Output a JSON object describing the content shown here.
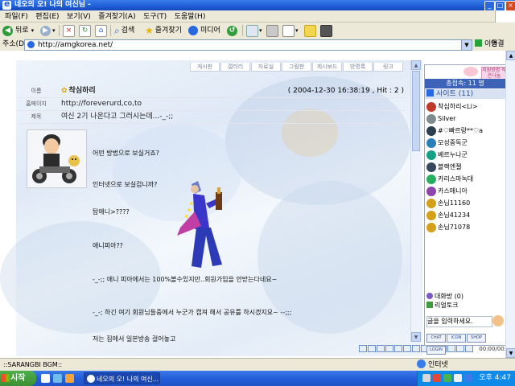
{
  "window": {
    "title": "네오의 오! 나의 여신님 -"
  },
  "menu": [
    "파일(F)",
    "편집(E)",
    "보기(V)",
    "즐겨찾기(A)",
    "도구(T)",
    "도움말(H)"
  ],
  "toolbar": {
    "back": "뒤로",
    "search": "검색",
    "favorites": "즐겨찾기",
    "media": "미디어"
  },
  "address": {
    "label": "주소(D)",
    "url": "http://amgkorea.net/",
    "go": "이동",
    "links": "연결"
  },
  "top_nav": [
    "게시판",
    "갤러리",
    "자료실",
    "그림판",
    "게시보드",
    "방명록",
    "링크"
  ],
  "post": {
    "name_label": "이름",
    "author": "착심하리",
    "date": "( 2004-12-30 16:38:19 , Hit : 2 )",
    "homepage_label": "홈페이지",
    "homepage": "http://foreverurd,co,to",
    "subject_label": "제목",
    "subject": "여신 2기 나온다고 그러시는데...-_-;;",
    "lines": [
      "어떤 방법으로 보실거죠?",
      "인터넷으로 보실겁니까?",
      "탑애니>????",
      "애니피아??",
      "-_-;; 애니 피아에서는 100%볼수있지만..회원가입을 안받는다네요~",
      "-_-; 하긴 여기 회원님들중에서 누군가 캡져 해서 공유를 하시겠지요~ --;;;",
      "저는 집에서 일본방송 걸어놓고"
    ]
  },
  "player": {
    "time": "00:00/00:00"
  },
  "sidebar": {
    "badge": "지원방명 작은나눔",
    "count": "총접속: 11 명",
    "site_header": "사이트 (11)",
    "users": [
      {
        "name": "착심하리<Li>",
        "color": "#c0392b"
      },
      {
        "name": "Silver",
        "color": "#7f8c8d"
      },
      {
        "name": "#♡빠르랑**♡a",
        "color": "#2c3e50"
      },
      {
        "name": "모성중독군",
        "color": "#2980b9"
      },
      {
        "name": "베르누나군",
        "color": "#16a085"
      },
      {
        "name": "블랙엔젤",
        "color": "#34495e"
      },
      {
        "name": "카리스마녹대",
        "color": "#27ae60"
      },
      {
        "name": "카스매니아",
        "color": "#8e44ad"
      },
      {
        "name": "손님11160",
        "color": "#d4a017"
      },
      {
        "name": "손님41234",
        "color": "#d4a017"
      },
      {
        "name": "손님71078",
        "color": "#d4a017"
      }
    ],
    "chatroom": "대화방 (0)",
    "realtalk": "리얼토크",
    "input_placeholder": "글을 입력하세요.",
    "buttons": [
      "CHAT",
      "ICON",
      "SHOP",
      "LOGIN"
    ]
  },
  "status": {
    "text": "::SARANGBI BGM::",
    "zone": "인터넷"
  },
  "taskbar": {
    "start": "시작",
    "item": "네오의 오! 나의 여신...",
    "clock": "오후 4:47"
  }
}
